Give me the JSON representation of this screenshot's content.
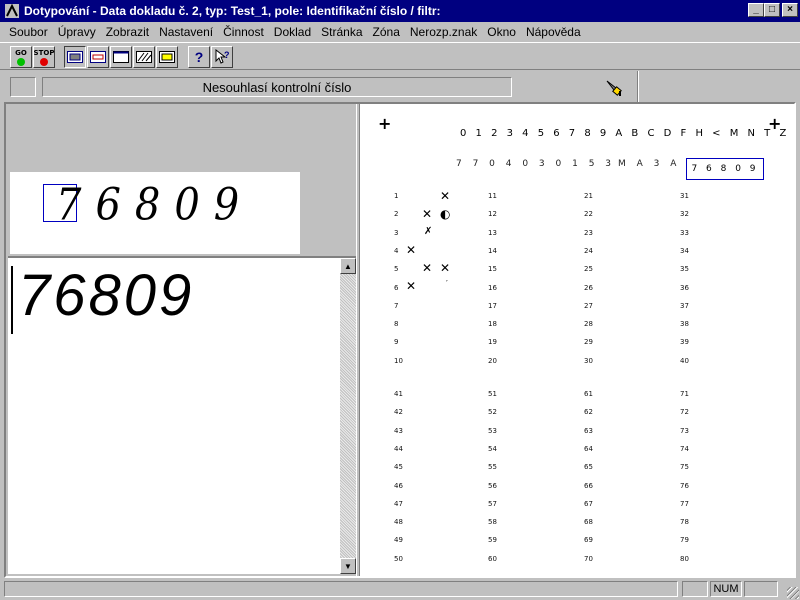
{
  "window": {
    "title": "Dotypování - Data dokladu č. 2,  typ: Test_1,  pole: Identifikační číslo / filtr:"
  },
  "menu": [
    {
      "label": "Soubor",
      "name": "menu-soubor"
    },
    {
      "label": "Úpravy",
      "name": "menu-upravy"
    },
    {
      "label": "Zobrazit",
      "name": "menu-zobrazit"
    },
    {
      "label": "Nastavení",
      "name": "menu-nastaveni"
    },
    {
      "label": "Činnost",
      "name": "menu-cinnost"
    },
    {
      "label": "Doklad",
      "name": "menu-doklad"
    },
    {
      "label": "Stránka",
      "name": "menu-stranka"
    },
    {
      "label": "Zóna",
      "name": "menu-zona"
    },
    {
      "label": "Nerozp.znak",
      "name": "menu-nerozp-znak"
    },
    {
      "label": "Okno",
      "name": "menu-okno"
    },
    {
      "label": "Nápověda",
      "name": "menu-napoveda"
    }
  ],
  "toolbar": {
    "go_label": "GO",
    "stop_label": "STOP",
    "colors": {
      "go": "#00c000",
      "stop": "#e00000"
    }
  },
  "status_message": "Nesouhlasí kontrolní číslo",
  "snippet": {
    "digits": "76809"
  },
  "editor": {
    "value": "76809"
  },
  "form": {
    "alphabet": "0 1 2 3 4 5 6 7 8 9 A B C D F H < M N T Z",
    "printed_left": "7 7 0 4 0 3 0 1 5 3",
    "printed_mid": "M A 3 A",
    "field_value": "7 6 8 0 9",
    "rows_top": [
      [
        "1",
        "11",
        "21",
        "31"
      ],
      [
        "2",
        "12",
        "22",
        "32"
      ],
      [
        "3",
        "13",
        "23",
        "33"
      ],
      [
        "4",
        "14",
        "24",
        "34"
      ],
      [
        "5",
        "15",
        "25",
        "35"
      ],
      [
        "6",
        "16",
        "26",
        "36"
      ],
      [
        "7",
        "17",
        "27",
        "37"
      ],
      [
        "8",
        "18",
        "28",
        "38"
      ],
      [
        "9",
        "19",
        "29",
        "39"
      ],
      [
        "10",
        "20",
        "30",
        "40"
      ]
    ],
    "rows_bottom": [
      [
        "41",
        "51",
        "61",
        "71"
      ],
      [
        "42",
        "52",
        "62",
        "72"
      ],
      [
        "43",
        "53",
        "63",
        "73"
      ],
      [
        "44",
        "54",
        "64",
        "74"
      ],
      [
        "45",
        "55",
        "65",
        "75"
      ],
      [
        "46",
        "56",
        "66",
        "76"
      ],
      [
        "47",
        "57",
        "67",
        "77"
      ],
      [
        "48",
        "58",
        "68",
        "78"
      ],
      [
        "49",
        "59",
        "69",
        "79"
      ],
      [
        "50",
        "60",
        "70",
        "80"
      ]
    ]
  },
  "statusbar": {
    "num": "NUM"
  }
}
